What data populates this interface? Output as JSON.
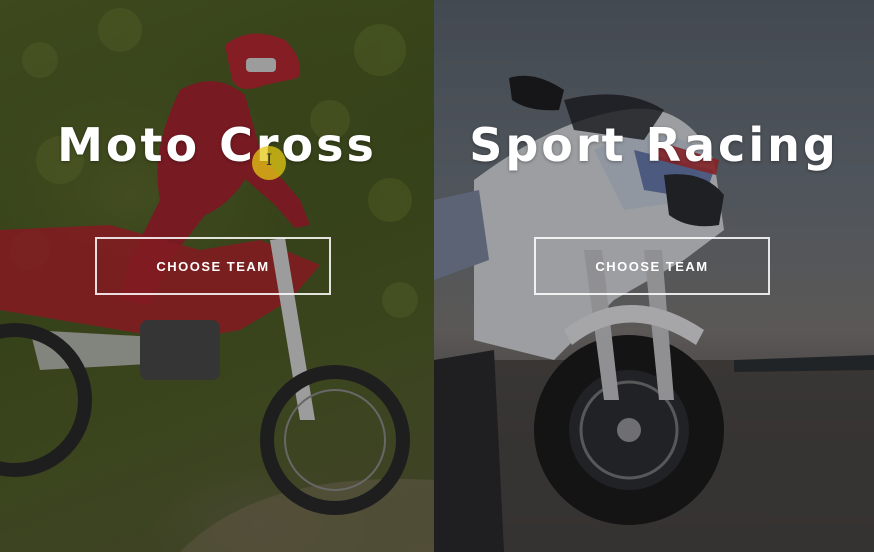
{
  "panels": [
    {
      "title": "Moto Cross",
      "button_label": "CHOOSE TEAM",
      "image": "motocross-rider-icon"
    },
    {
      "title": "Sport Racing",
      "button_label": "CHOOSE TEAM",
      "image": "sport-bike-icon"
    }
  ],
  "colors": {
    "title_text": "#ffffff",
    "button_border": "#ffffff",
    "cursor_highlight": "#e6c814"
  }
}
